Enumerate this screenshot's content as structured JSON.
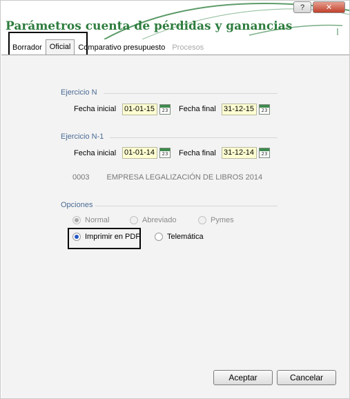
{
  "window": {
    "title": "Parámetros cuenta de pérdidas y ganancias",
    "help_label": "?",
    "close_label": "✕"
  },
  "tabs": [
    {
      "label": "Borrador",
      "state": "normal"
    },
    {
      "label": "Oficial",
      "state": "active"
    },
    {
      "label": "Comparativo presupuesto",
      "state": "normal"
    },
    {
      "label": "Procesos",
      "state": "disabled"
    }
  ],
  "ejercicio_n": {
    "label": "Ejercicio N",
    "fecha_inicial_label": "Fecha inicial",
    "fecha_inicial": "01-01-15",
    "fecha_final_label": "Fecha final",
    "fecha_final": "31-12-15"
  },
  "ejercicio_n1": {
    "label": "Ejercicio N-1",
    "fecha_inicial_label": "Fecha inicial",
    "fecha_inicial": "01-01-14",
    "fecha_final_label": "Fecha final",
    "fecha_final": "31-12-14"
  },
  "calendar_icon_number": "23",
  "company": {
    "code": "0003",
    "name": "EMPRESA LEGALIZACIÓN DE LIBROS  2014"
  },
  "opciones": {
    "label": "Opciones",
    "format_options": [
      {
        "label": "Normal",
        "checked": true,
        "disabled": true
      },
      {
        "label": "Abreviado",
        "checked": false,
        "disabled": true
      },
      {
        "label": "Pymes",
        "checked": false,
        "disabled": true
      }
    ],
    "output_options": [
      {
        "label": "Imprimir en PDF",
        "checked": true,
        "disabled": false
      },
      {
        "label": "Telemática",
        "checked": false,
        "disabled": false
      }
    ]
  },
  "buttons": {
    "accept": "Aceptar",
    "cancel": "Cancelar"
  },
  "colors": {
    "title": "#2e7d3e",
    "section_label": "#4a6a94",
    "date_field_bg": "#ffffd2",
    "panel_bg": "#f3f3f3"
  }
}
